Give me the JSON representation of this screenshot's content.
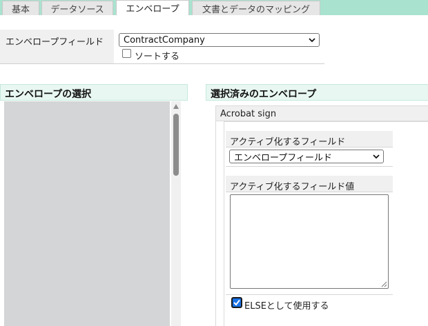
{
  "tabs": [
    {
      "label": "基本",
      "active": false
    },
    {
      "label": "データソース",
      "active": false
    },
    {
      "label": "エンベロープ",
      "active": true
    },
    {
      "label": "文書とデータのマッピング",
      "active": false
    }
  ],
  "envelope_field": {
    "label": "エンベロープフィールド",
    "selected": "ContractCompany",
    "sort_label": "ソートする",
    "sort_checked": false
  },
  "left_panel": {
    "title": "エンベロープの選択"
  },
  "right_panel": {
    "title": "選択済みのエンベロープ",
    "envelope_name": "Acrobat sign",
    "activate_field_label": "アクティブ化するフィールド",
    "activate_field_selected": "エンベロープフィールド",
    "activate_value_label": "アクティブ化するフィールド値",
    "activate_value": "",
    "else_label": "ELSEとして使用する",
    "else_checked": true
  },
  "colors": {
    "tab_bar": "#a9e3cf",
    "panel_header": "#e8f7f2",
    "checkbox_accent": "#1a73e8"
  }
}
